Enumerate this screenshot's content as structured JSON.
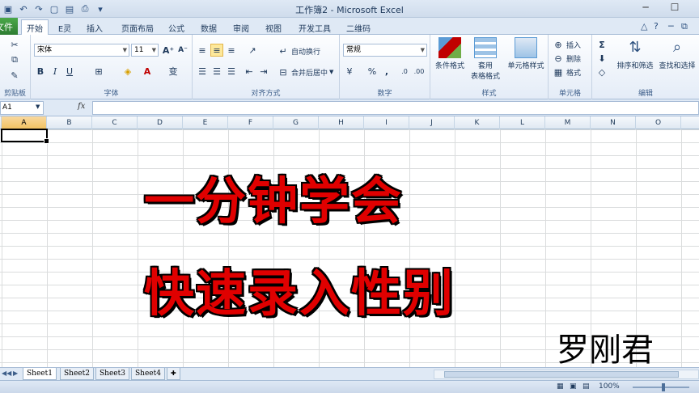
{
  "window": {
    "title": "工作簿2 - Microsoft Excel",
    "minimize": "─",
    "maximize": "☐"
  },
  "tabs": [
    {
      "label": "文件"
    },
    {
      "label": "开始"
    },
    {
      "label": "E灵"
    },
    {
      "label": "插入"
    },
    {
      "label": "页面布局"
    },
    {
      "label": "公式"
    },
    {
      "label": "数据"
    },
    {
      "label": "审阅"
    },
    {
      "label": "视图"
    },
    {
      "label": "开发工具"
    },
    {
      "label": "二维码"
    }
  ],
  "ribbon": {
    "clipboard_label": "剪贴板",
    "font_label": "字体",
    "font_name": "宋体",
    "font_size": "11",
    "align_label": "对齐方式",
    "wrap_text": "自动换行",
    "merge_center": "合并后居中",
    "number_label": "数字",
    "number_format": "常规",
    "styles_label": "样式",
    "cond_format": "条件格式",
    "table_format_1": "套用",
    "table_format_2": "表格格式",
    "cell_styles": "单元格样式",
    "cells_label": "单元格",
    "insert": "插入",
    "delete": "删除",
    "format": "格式",
    "edit_label": "编辑",
    "sort_filter": "排序和筛选",
    "find_select": "查找和选择"
  },
  "formula_bar": {
    "name_box": "A1",
    "fx": "fx",
    "value": ""
  },
  "columns": [
    "A",
    "B",
    "C",
    "D",
    "E",
    "F",
    "G",
    "H",
    "I",
    "J",
    "K",
    "L",
    "M",
    "N",
    "O"
  ],
  "overlay": {
    "line1": "一分钟学会",
    "line2": "快速录入性别",
    "author": "罗刚君"
  },
  "sheets": [
    "Sheet1",
    "Sheet2",
    "Sheet3",
    "Sheet4"
  ],
  "status": {
    "zoom": "100%"
  },
  "colors": {
    "overlay_text": "#e00000",
    "file_tab": "#2e7d32"
  }
}
